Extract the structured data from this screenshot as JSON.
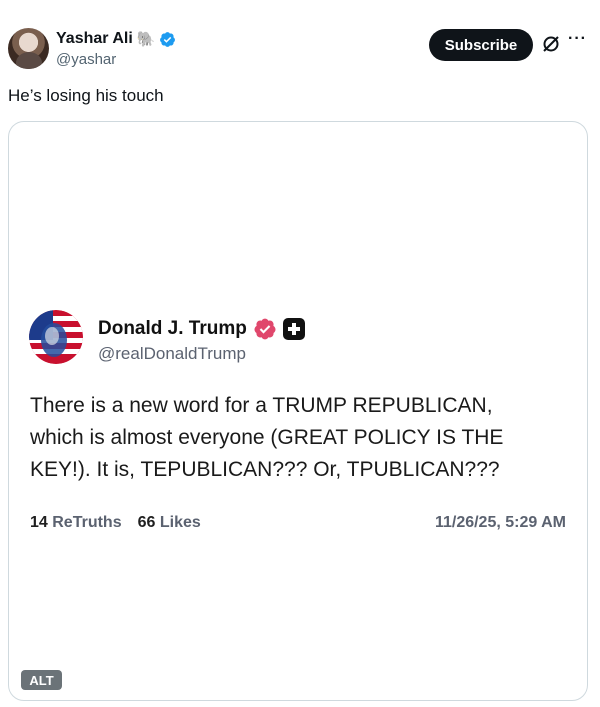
{
  "header": {
    "display_name": "Yashar Ali",
    "emoji": "🐘",
    "handle": "@yashar",
    "subscribe_label": "Subscribe",
    "more_label": "···"
  },
  "tweet": {
    "text": "He’s losing his touch"
  },
  "media": {
    "alt_label": "ALT",
    "truth_post": {
      "name": "Donald J. Trump",
      "handle": "@realDonaldTrump",
      "body_lines": [
        "There is a new word for a TRUMP REPUBLICAN,",
        "which is almost everyone (GREAT POLICY IS THE",
        "KEY!). It is, TEPUBLICAN??? Or, TPUBLICAN???"
      ],
      "retruths_count": "14",
      "retruths_label": "ReTruths",
      "likes_count": "66",
      "likes_label": "Likes",
      "timestamp": "11/26/25, 5:29 AM"
    }
  },
  "colors": {
    "verified_blue": "#1d9bf0",
    "truth_badge": "#e0476c",
    "subscribe_bg": "#0f1419"
  }
}
